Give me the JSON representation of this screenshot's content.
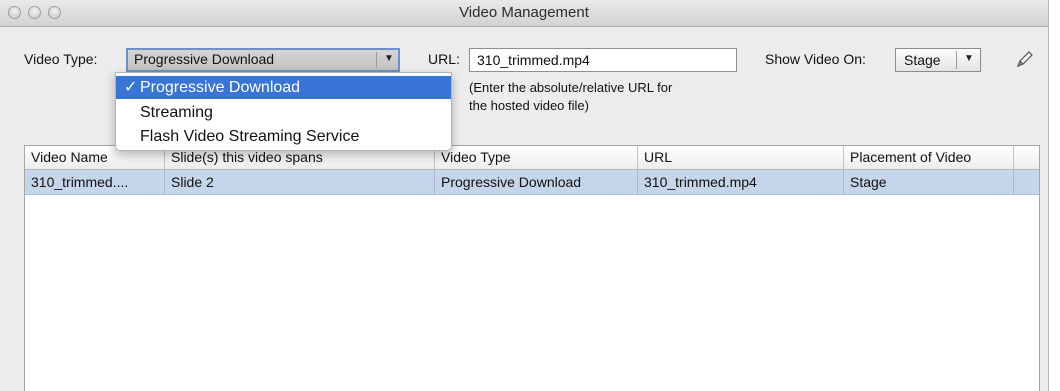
{
  "window": {
    "title": "Video Management"
  },
  "form": {
    "video_type_label": "Video Type:",
    "video_type_value": "Progressive Download",
    "url_label": "URL:",
    "url_value": "310_trimmed.mp4",
    "url_hint_line1": "(Enter the absolute/relative URL for",
    "url_hint_line2": "the hosted video file)",
    "show_on_label": "Show Video On:",
    "show_on_value": "Stage"
  },
  "dropdown": {
    "check_mark": "✓",
    "options": [
      "Progressive Download",
      "Streaming",
      "Flash Video Streaming Service"
    ],
    "selected_index": 0
  },
  "table": {
    "columns": [
      "Video Name",
      "Slide(s) this video spans",
      "Video Type",
      "URL",
      "Placement of Video"
    ],
    "rows": [
      [
        "310_trimmed....",
        "Slide 2",
        "Progressive Download",
        "310_trimmed.mp4",
        "Stage"
      ]
    ]
  },
  "colors": {
    "selection": "#3875d7",
    "row_highlight": "#c5d5ea",
    "focus_ring": "#6b92c8"
  },
  "icons": {
    "edit": "pencil-icon",
    "dropdown_arrow": "triangle-down-icon"
  }
}
